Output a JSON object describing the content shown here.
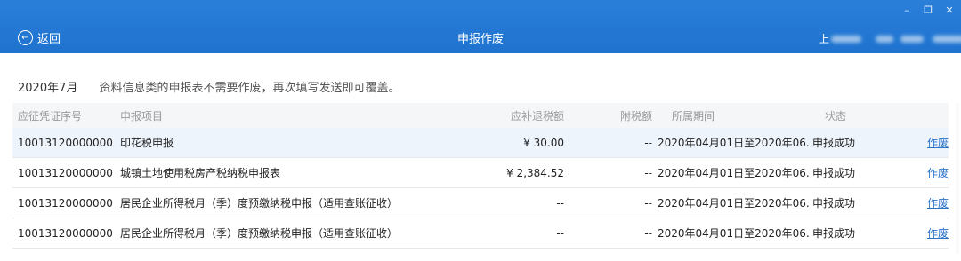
{
  "window": {
    "back_label": "返回",
    "title": "申报作废",
    "user_text": "上",
    "controls": {
      "minimize": "–",
      "restore": "❐",
      "close": "✕"
    }
  },
  "filter": {
    "period": "2020年7月",
    "tip": "资料信息类的申报表不需要作废，再次填写发送即可覆盖。"
  },
  "table": {
    "headers": [
      "应征凭证序号",
      "申报项目",
      "应补退税额",
      "附税额",
      "所属期间",
      "状态",
      ""
    ],
    "rows": [
      {
        "id": "10013120000000...",
        "item": "印花税申报",
        "amount": "¥ 30.00",
        "surtax": "--",
        "period": "2020年04月01日至2020年06...",
        "status": "申报成功",
        "action": "作废"
      },
      {
        "id": "10013120000000...",
        "item": "城镇土地使用税房产税纳税申报表",
        "amount": "¥ 2,384.52",
        "surtax": "--",
        "period": "2020年04月01日至2020年06...",
        "status": "申报成功",
        "action": "作废"
      },
      {
        "id": "10013120000000...",
        "item": "居民企业所得税月（季）度预缴纳税申报（适用查账征收）",
        "amount": "--",
        "surtax": "--",
        "period": "2020年04月01日至2020年06...",
        "status": "申报成功",
        "action": "作废"
      },
      {
        "id": "10013120000000...",
        "item": "居民企业所得税月（季）度预缴纳税申报（适用查账征收）",
        "amount": "--",
        "surtax": "--",
        "period": "2020年04月01日至2020年06...",
        "status": "申报成功",
        "action": "作废"
      }
    ]
  }
}
